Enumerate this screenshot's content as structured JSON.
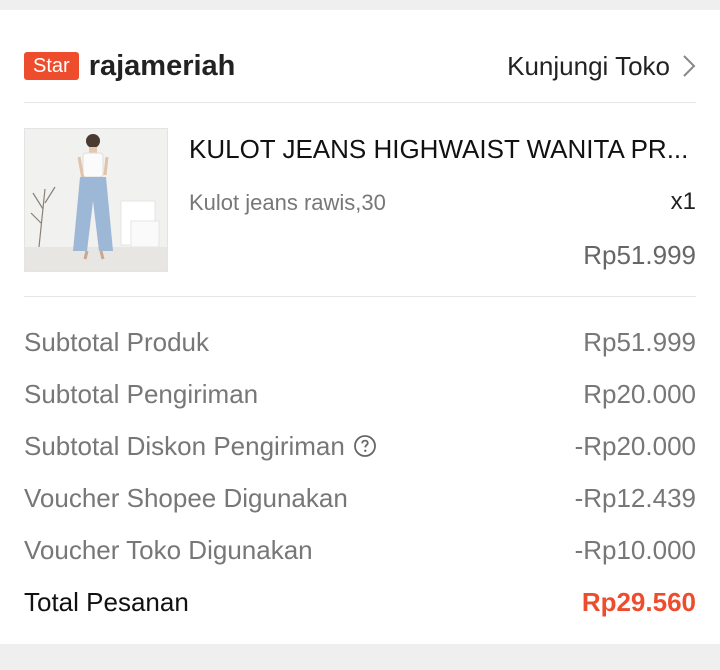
{
  "shop": {
    "badge": "Star",
    "name": "rajameriah",
    "visit_label": "Kunjungi Toko"
  },
  "product": {
    "name": "KULOT JEANS HIGHWAIST WANITA PR...",
    "variant": "Kulot jeans rawis,30",
    "quantity": "x1",
    "price": "Rp51.999"
  },
  "summary": {
    "subtotal_produk": {
      "label": "Subtotal Produk",
      "value": "Rp51.999"
    },
    "subtotal_pengiriman": {
      "label": "Subtotal Pengiriman",
      "value": "Rp20.000"
    },
    "subtotal_diskon_pengiriman": {
      "label": "Subtotal Diskon Pengiriman",
      "value": "-Rp20.000"
    },
    "voucher_shopee": {
      "label": "Voucher Shopee Digunakan",
      "value": "-Rp12.439"
    },
    "voucher_toko": {
      "label": "Voucher Toko Digunakan",
      "value": "-Rp10.000"
    },
    "total": {
      "label": "Total Pesanan",
      "value": "Rp29.560"
    }
  },
  "colors": {
    "accent": "#ee4d2d",
    "background": "#f2f2f2",
    "card": "#ffffff"
  },
  "icons": {
    "visit_arrow": "chevron-right-icon",
    "help": "question-circle-icon"
  }
}
